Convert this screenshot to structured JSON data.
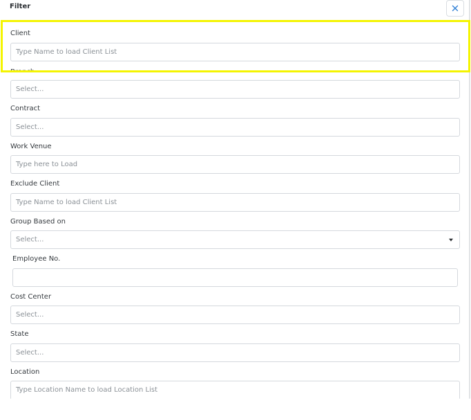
{
  "header": {
    "title": "Filter",
    "close_icon": "close-icon"
  },
  "colors": {
    "highlight": "#f4f400",
    "close_icon": "#2f7fd6"
  },
  "fields": {
    "client": {
      "label": "Client",
      "placeholder": "Type Name to load Client List"
    },
    "branch": {
      "label": "Branch",
      "placeholder": "Select..."
    },
    "contract": {
      "label": "Contract",
      "placeholder": "Select..."
    },
    "work_venue": {
      "label": "Work Venue",
      "placeholder": "Type here to Load"
    },
    "exclude_client": {
      "label": "Exclude Client",
      "placeholder": "Type Name to load Client List"
    },
    "group_based_on": {
      "label": "Group Based on",
      "placeholder": "Select..."
    },
    "employee_no": {
      "label": "Employee No.",
      "value": ""
    },
    "cost_center": {
      "label": "Cost Center",
      "placeholder": "Select..."
    },
    "state": {
      "label": "State",
      "placeholder": "Select..."
    },
    "location": {
      "label": "Location",
      "placeholder": "Type Location Name to load Location List"
    }
  }
}
